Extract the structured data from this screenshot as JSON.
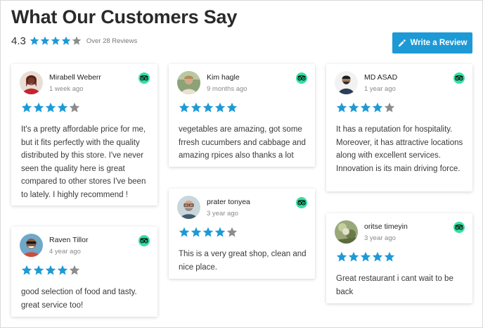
{
  "header": {
    "title": "What Our Customers Say",
    "average": "4.3",
    "summary_stars": 4.3,
    "review_count": "Over 28 Reviews",
    "write_button": "Write a Review"
  },
  "colors": {
    "star_filled": "#1d9ad6",
    "star_empty": "#8c8c8c",
    "button": "#1d9ad6",
    "tripadvisor": "#34e0a1"
  },
  "icons": {
    "star": "star-icon",
    "pen": "pencil-icon",
    "source": "tripadvisor-icon"
  },
  "reviews": [
    {
      "name": "Mirabell Weberr",
      "time": "1 week ago",
      "rating": 4,
      "text": "It's a pretty affordable price for me, but it fits perfectly with the quality distributed by this store. I've never seen the quality here is great compared to other stores I've been to lately. I highly recommend !"
    },
    {
      "name": "Kim hagle",
      "time": "9 months ago",
      "rating": 5,
      "text": "vegetables are amazing, got some frresh cucumbers and cabbage and amazing rpices also thanks a lot"
    },
    {
      "name": "MD ASAD",
      "time": "1 year ago",
      "rating": 4,
      "text": "It has a reputation for hospitality. Moreover, it has attractive locations along with excellent services. Innovation is its main driving force."
    },
    {
      "name": "prater tonyea",
      "time": "3 year ago",
      "rating": 4,
      "text": "This is a very great shop, clean and nice place."
    },
    {
      "name": "Raven Tillor",
      "time": "4 year ago",
      "rating": 4,
      "text": "good selection of food and tasty. great service too!"
    },
    {
      "name": "oritse timeyin",
      "time": "3 year ago",
      "rating": 5,
      "text": "Great restaurant i cant wait to be back"
    }
  ]
}
